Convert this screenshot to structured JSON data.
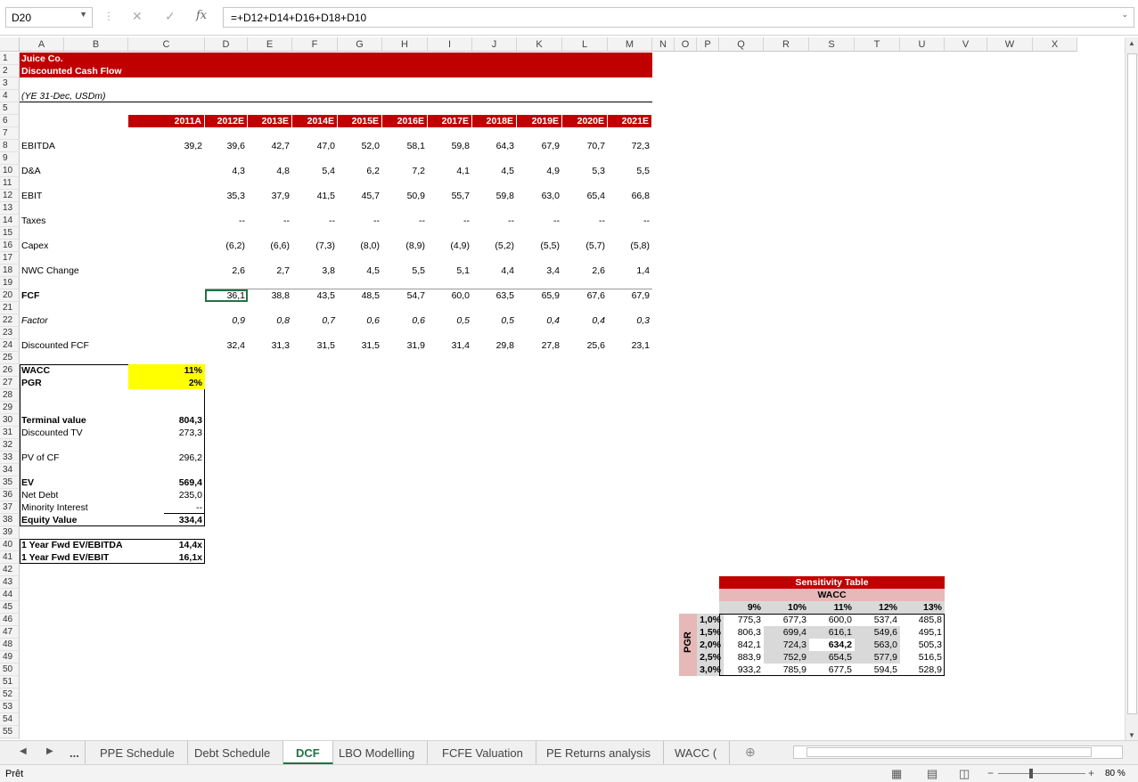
{
  "namebox": "D20",
  "formula": "=+D12+D14+D16+D18+D10",
  "columns": [
    "A",
    "B",
    "C",
    "D",
    "E",
    "F",
    "G",
    "H",
    "I",
    "J",
    "K",
    "L",
    "M",
    "N",
    "O",
    "P",
    "Q",
    "R",
    "S",
    "T",
    "U",
    "V",
    "W",
    "X"
  ],
  "title": "Juice Co.",
  "subtitle": "Discounted Cash Flow",
  "units": "(YE 31-Dec, USDm)",
  "years": [
    "2011A",
    "2012E",
    "2013E",
    "2014E",
    "2015E",
    "2016E",
    "2017E",
    "2018E",
    "2019E",
    "2020E",
    "2021E"
  ],
  "rows": [
    {
      "r": 8,
      "label": "EBITDA",
      "style": "",
      "vals": [
        "39,2",
        "39,6",
        "42,7",
        "47,0",
        "52,0",
        "58,1",
        "59,8",
        "64,3",
        "67,9",
        "70,7",
        "72,3"
      ]
    },
    {
      "r": 10,
      "label": "D&A",
      "style": "",
      "vals": [
        "",
        "4,3",
        "4,8",
        "5,4",
        "6,2",
        "7,2",
        "4,1",
        "4,5",
        "4,9",
        "5,3",
        "5,5"
      ]
    },
    {
      "r": 12,
      "label": "EBIT",
      "style": "",
      "vals": [
        "",
        "35,3",
        "37,9",
        "41,5",
        "45,7",
        "50,9",
        "55,7",
        "59,8",
        "63,0",
        "65,4",
        "66,8"
      ]
    },
    {
      "r": 14,
      "label": "Taxes",
      "style": "",
      "vals": [
        "",
        "--",
        "--",
        "--",
        "--",
        "--",
        "--",
        "--",
        "--",
        "--",
        "--"
      ]
    },
    {
      "r": 16,
      "label": "Capex",
      "style": "",
      "vals": [
        "",
        "(6,2)",
        "(6,6)",
        "(7,3)",
        "(8,0)",
        "(8,9)",
        "(4,9)",
        "(5,2)",
        "(5,5)",
        "(5,7)",
        "(5,8)"
      ]
    },
    {
      "r": 18,
      "label": "NWC Change",
      "style": "",
      "vals": [
        "",
        "2,6",
        "2,7",
        "3,8",
        "4,5",
        "5,5",
        "5,1",
        "4,4",
        "3,4",
        "2,6",
        "1,4"
      ]
    },
    {
      "r": 20,
      "label": "FCF",
      "style": "b",
      "vals": [
        "",
        "36,1",
        "38,8",
        "43,5",
        "48,5",
        "54,7",
        "60,0",
        "63,5",
        "65,9",
        "67,6",
        "67,9"
      ]
    },
    {
      "r": 22,
      "label": "Factor",
      "style": "i",
      "vals": [
        "",
        "0,9",
        "0,8",
        "0,7",
        "0,6",
        "0,6",
        "0,5",
        "0,5",
        "0,4",
        "0,4",
        "0,3"
      ]
    },
    {
      "r": 24,
      "label": "Discounted FCF",
      "style": "",
      "vals": [
        "",
        "32,4",
        "31,3",
        "31,5",
        "31,5",
        "31,9",
        "31,4",
        "29,8",
        "27,8",
        "25,6",
        "23,1"
      ]
    }
  ],
  "summary": [
    {
      "r": 26,
      "label": "WACC",
      "value": "11%",
      "bold": true,
      "yellow": true
    },
    {
      "r": 27,
      "label": "PGR",
      "value": "2%",
      "bold": true,
      "yellow": true
    },
    {
      "r": 30,
      "label": "Terminal value",
      "value": "804,3",
      "bold": true
    },
    {
      "r": 31,
      "label": "Discounted TV",
      "value": "273,3",
      "bold": false
    },
    {
      "r": 33,
      "label": "PV of CF",
      "value": "296,2",
      "bold": false
    },
    {
      "r": 35,
      "label": "EV",
      "value": "569,4",
      "bold": true
    },
    {
      "r": 36,
      "label": "Net Debt",
      "value": "235,0",
      "bold": false
    },
    {
      "r": 37,
      "label": "Minority Interest",
      "value": "--",
      "bold": false
    },
    {
      "r": 38,
      "label": "Equity Value",
      "value": "334,4",
      "bold": true
    }
  ],
  "multiples": [
    {
      "r": 40,
      "label": "1 Year Fwd EV/EBITDA",
      "value": "14,4x"
    },
    {
      "r": 41,
      "label": "1 Year Fwd EV/EBIT",
      "value": "16,1x"
    }
  ],
  "sensitivity": {
    "title": "Sensitivity Table",
    "wacc_label": "WACC",
    "pgr_label": "PGR",
    "wacc": [
      "9%",
      "10%",
      "11%",
      "12%",
      "13%"
    ],
    "pgr": [
      "1,0%",
      "1,5%",
      "2,0%",
      "2,5%",
      "3,0%"
    ],
    "values": [
      [
        "775,3",
        "677,3",
        "600,0",
        "537,4",
        "485,8"
      ],
      [
        "806,3",
        "699,4",
        "616,1",
        "549,6",
        "495,1"
      ],
      [
        "842,1",
        "724,3",
        "634,2",
        "563,0",
        "505,3"
      ],
      [
        "883,9",
        "752,9",
        "654,5",
        "577,9",
        "516,5"
      ],
      [
        "933,2",
        "785,9",
        "677,5",
        "594,5",
        "528,9"
      ]
    ]
  },
  "tabs": [
    "...",
    "PPE Schedule",
    "Debt Schedule",
    "DCF",
    "LBO Modelling",
    "FCFE Valuation",
    "PE Returns analysis",
    "WACC ("
  ],
  "active_tab": "DCF",
  "status": "Prêt",
  "zoom": "80 %",
  "colors": {
    "red": "#c00000",
    "yellow": "#ffff00",
    "pink": "#e6b8b7",
    "gray": "#d9d9d9",
    "green": "#217346"
  }
}
